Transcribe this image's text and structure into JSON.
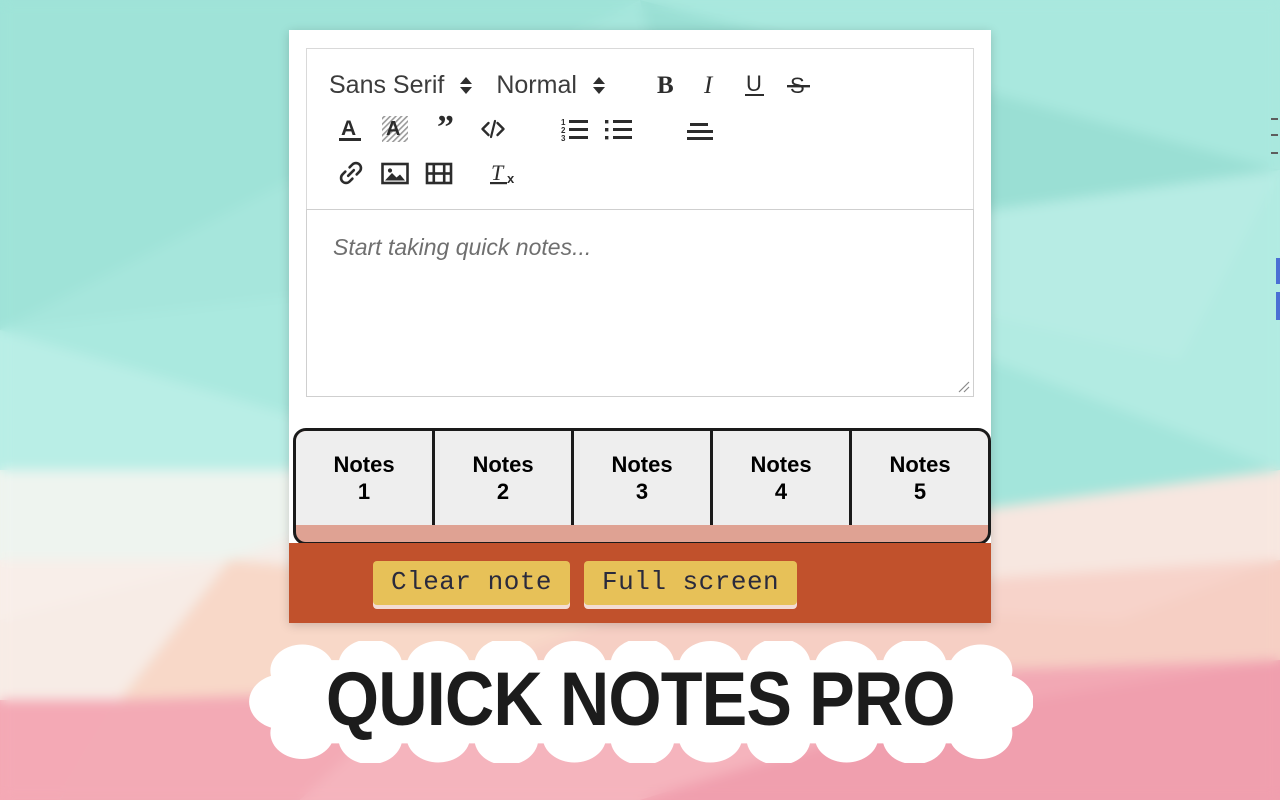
{
  "app": {
    "title": "QUICK NOTES PRO"
  },
  "editor": {
    "toolbar": {
      "font_picker": {
        "name": "font-family-picker",
        "value": "Sans Serif",
        "arrow_icon": "updown-chevron-icon"
      },
      "size_picker": {
        "name": "font-size-picker",
        "value": "Normal",
        "arrow_icon": "updown-chevron-icon"
      },
      "row1_buttons": [
        {
          "icon": "bold-icon",
          "label": "B"
        },
        {
          "icon": "italic-icon",
          "label": "I"
        },
        {
          "icon": "underline-icon",
          "label": "U"
        },
        {
          "icon": "strikethrough-icon",
          "label": "S"
        }
      ],
      "row2_buttons": [
        {
          "icon": "text-color-icon",
          "label": "Text color"
        },
        {
          "icon": "background-color-icon",
          "label": "Background color"
        },
        {
          "icon": "blockquote-icon",
          "label": "Blockquote"
        },
        {
          "icon": "code-block-icon",
          "label": "Code block"
        },
        {
          "icon": "ordered-list-icon",
          "label": "Ordered list"
        },
        {
          "icon": "bullet-list-icon",
          "label": "Bullet list"
        },
        {
          "icon": "align-left-icon",
          "label": "Align"
        }
      ],
      "row3_buttons": [
        {
          "icon": "link-icon",
          "label": "Insert link"
        },
        {
          "icon": "image-icon",
          "label": "Insert image"
        },
        {
          "icon": "video-icon",
          "label": "Insert video"
        },
        {
          "icon": "clear-formatting-icon",
          "label": "Clear formatting"
        }
      ]
    },
    "note_placeholder": "Start taking quick notes...",
    "note_value": "",
    "resize_grip_icon": "resize-grip-icon"
  },
  "tabs": [
    {
      "line1": "Notes",
      "line2": "1"
    },
    {
      "line1": "Notes",
      "line2": "2"
    },
    {
      "line1": "Notes",
      "line2": "3"
    },
    {
      "line1": "Notes",
      "line2": "4"
    },
    {
      "line1": "Notes",
      "line2": "5"
    }
  ],
  "actions": {
    "clear_note_label": "Clear note",
    "full_screen_label": "Full screen"
  },
  "colors": {
    "tab_strip_base": "#dfa293",
    "action_bar": "#c1512c",
    "action_button": "#e7c158",
    "action_button_text": "#2a2a3c",
    "tab_background": "#eeeeee",
    "tab_border": "#1a1a1a",
    "card_background": "#ffffff",
    "placeholder_text": "#6f6f6f",
    "title_text": "#1c1c1c",
    "title_outline": "#ffffff",
    "background_mint": "#9fe3d8",
    "background_pink": "#f2a8b4",
    "edge_accent": "#4a6fd4"
  }
}
